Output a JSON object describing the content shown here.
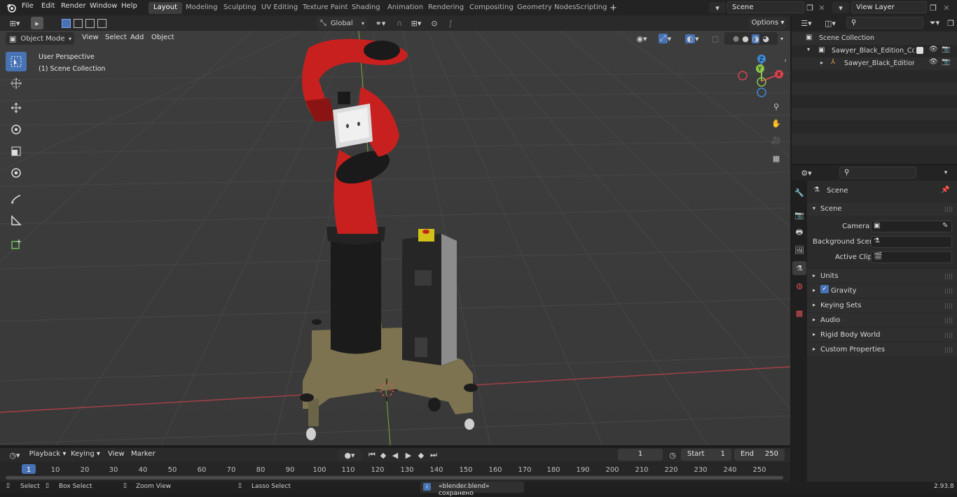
{
  "menu": [
    "File",
    "Edit",
    "Render",
    "Window",
    "Help"
  ],
  "workspaces": [
    "Layout",
    "Modeling",
    "Sculpting",
    "UV Editing",
    "Texture Paint",
    "Shading",
    "Animation",
    "Rendering",
    "Compositing",
    "Geometry Nodes",
    "Scripting"
  ],
  "active_workspace": "Layout",
  "scene_field": "Scene",
  "view_layer_field": "View Layer",
  "viewport": {
    "mode": "Object Mode",
    "menus": [
      "View",
      "Select",
      "Add",
      "Object"
    ],
    "orientation": "Global",
    "options_label": "Options",
    "overlay_line1": "User Perspective",
    "overlay_line2": "(1) Scene Collection",
    "gizmo_axes": {
      "x": "X",
      "y": "Y",
      "z": "Z"
    }
  },
  "outliner": {
    "root": "Scene Collection",
    "collection": "Sawyer_Black_Edition_Collab",
    "object": "Sawyer_Black_Edition_Co"
  },
  "properties": {
    "context_title": "Scene",
    "panel_title": "Scene",
    "camera_label": "Camera",
    "bg_scene_label": "Background Scene",
    "active_clip_label": "Active Clip",
    "panels": [
      "Units",
      "Gravity",
      "Keying Sets",
      "Audio",
      "Rigid Body World",
      "Custom Properties"
    ],
    "gravity_checked": true
  },
  "timeline": {
    "menus": [
      "Playback",
      "Keying",
      "View",
      "Marker"
    ],
    "current_frame": "1",
    "start_label": "Start",
    "start_value": "1",
    "end_label": "End",
    "end_value": "250",
    "ruler": [
      "1",
      "10",
      "20",
      "30",
      "40",
      "50",
      "60",
      "70",
      "80",
      "90",
      "100",
      "110",
      "120",
      "130",
      "140",
      "150",
      "160",
      "170",
      "180",
      "190",
      "200",
      "210",
      "220",
      "230",
      "240",
      "250"
    ]
  },
  "status": {
    "select": "Select",
    "box_select": "Box Select",
    "zoom_view": "Zoom View",
    "lasso_select": "Lasso Select",
    "message": "«blender.blend» сохранено",
    "version": "2.93.8"
  },
  "colors": {
    "accent": "#4772b3",
    "x_axis": "#d8434f",
    "y_axis": "#8bc34a",
    "z_axis": "#3f89d8",
    "robot_red": "#c8201e"
  }
}
